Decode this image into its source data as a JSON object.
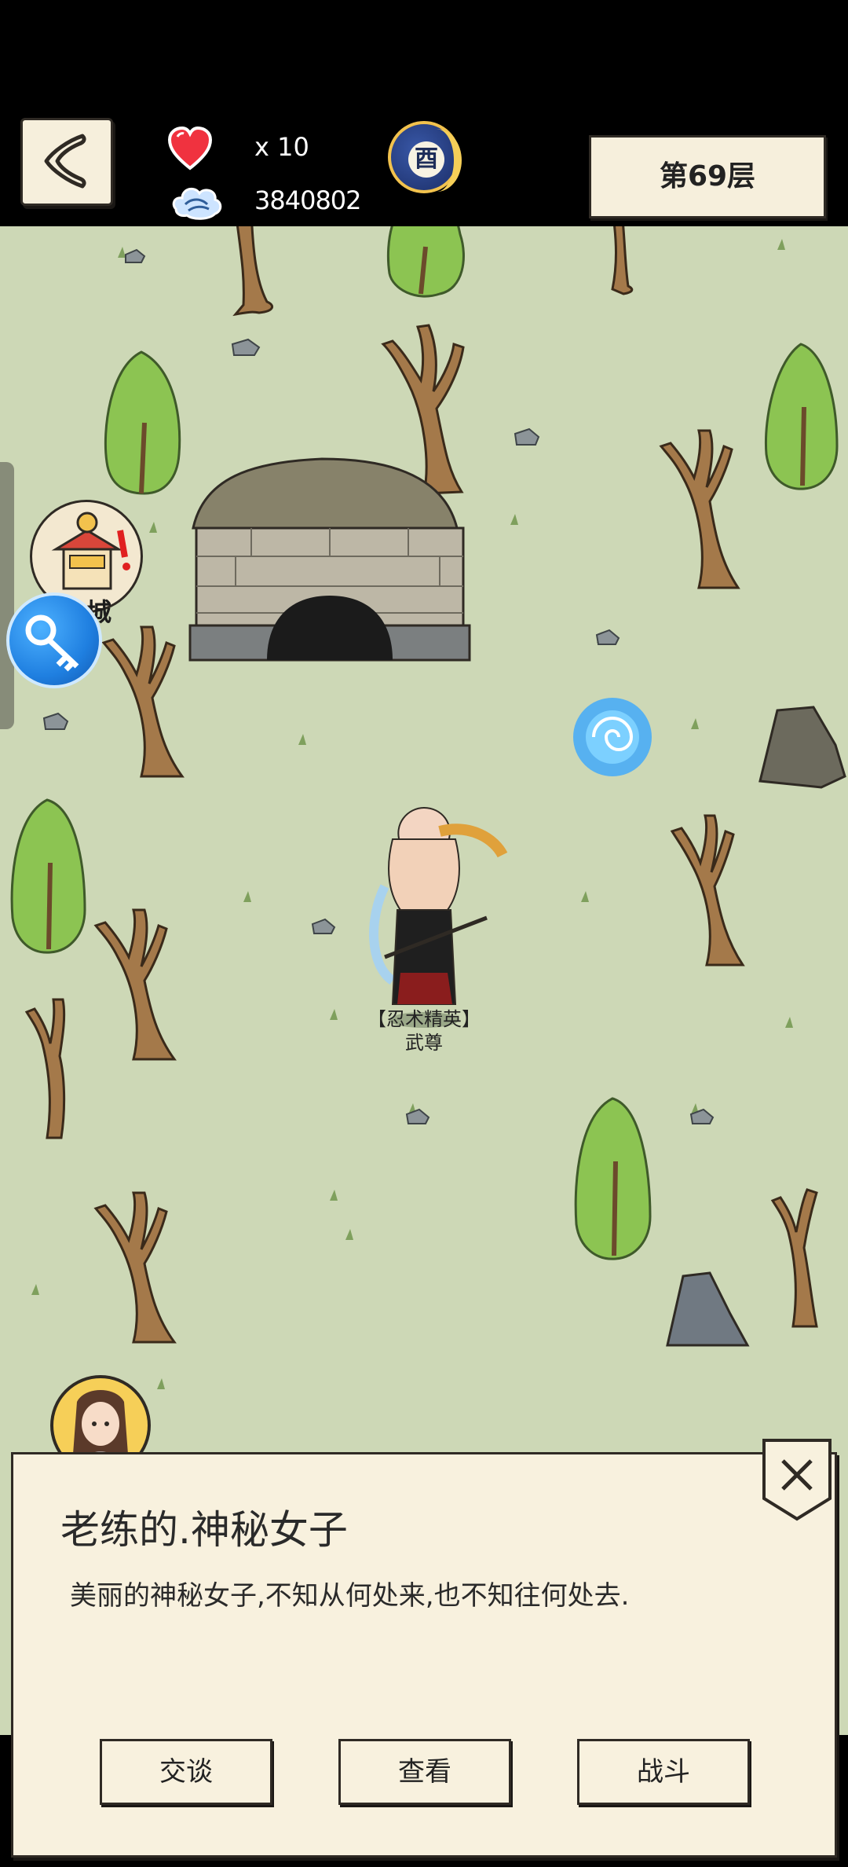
{
  "hud": {
    "lives": "x 10",
    "coins": "3840802",
    "time_glyph": "酉",
    "floor": "第69层"
  },
  "map": {
    "shop_label": "城",
    "npc_title": "【忍术精英】",
    "npc_name": "武尊"
  },
  "dialog": {
    "title": "老练的.神秘女子",
    "description": "美丽的神秘女子,不知从何处来,也不知往何处去.",
    "buttons": [
      "交谈",
      "查看",
      "战斗"
    ]
  },
  "colors": {
    "map_bg": "#cdd8b6",
    "panel_bg": "#f8f1de",
    "portal": "#3aa8ff"
  },
  "icons": {
    "back": "back-chevron-icon",
    "lives": "heart-icon",
    "coins": "cloud-coin-icon",
    "time": "moon-time-icon",
    "shop": "shop-stall-icon",
    "key": "key-icon",
    "close": "close-icon"
  }
}
